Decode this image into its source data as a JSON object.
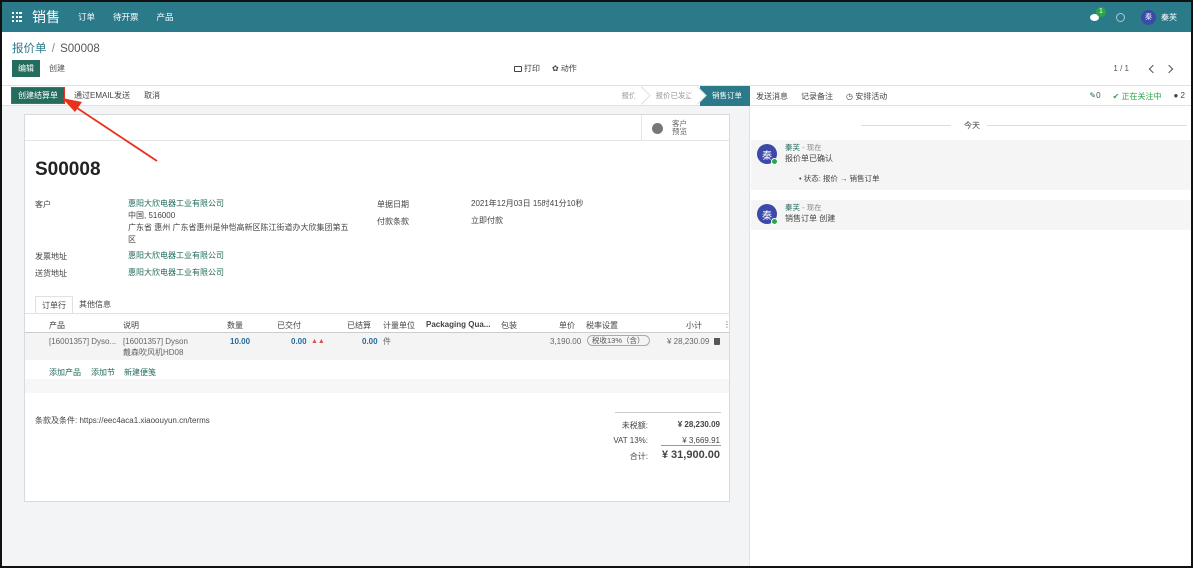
{
  "navbar": {
    "brand": "销售",
    "menu": [
      "订单",
      "待开票",
      "产品"
    ],
    "chat_badge": "1",
    "user_initial": "秦",
    "user_name": "秦芙"
  },
  "control": {
    "breadcrumb_parent": "报价单",
    "breadcrumb_sep": "/",
    "breadcrumb_current": "S00008",
    "edit": "编辑",
    "create": "创建",
    "print": "打印",
    "action": "动作",
    "pager": "1 / 1"
  },
  "statusbar": {
    "create_invoice": "创建结算单",
    "send_email": "通过EMAIL发送",
    "cancel": "取消",
    "stages": [
      "报价",
      "报价已发送",
      "销售订单"
    ],
    "active_stage": "销售订单"
  },
  "sheet": {
    "preview_label": "客户预览",
    "title": "S00008",
    "customer_label": "客户",
    "customer_name": "惠阳大欣电器工业有限公司",
    "customer_addr1": "中国, 516000",
    "customer_addr2": "广东省 惠州 广东省惠州是仲恺高新区陈江街道办大欣集团第五",
    "customer_addr3": "区",
    "invoice_addr_label": "发票地址",
    "invoice_addr": "惠阳大欣电器工业有限公司",
    "delivery_addr_label": "送货地址",
    "delivery_addr": "惠阳大欣电器工业有限公司",
    "date_label": "单据日期",
    "date_value": "2021年12月03日 15时41分10秒",
    "terms_label": "付款条款",
    "terms_value": "立即付款",
    "tabs": [
      "订单行",
      "其他信息"
    ],
    "columns": {
      "product": "产品",
      "description": "说明",
      "qty": "数量",
      "delivered": "已交付",
      "invoiced": "已结算",
      "uom": "计量单位",
      "packaging_qty": "Packaging Qua...",
      "package": "包装",
      "price": "单价",
      "tax": "税率设置",
      "subtotal": "小计"
    },
    "line": {
      "product": "[16001357] Dyso...",
      "desc1": "[16001357] Dyson",
      "desc2": "戴森吹风机HD08",
      "qty": "10.00",
      "delivered": "0.00",
      "invoiced": "0.00",
      "uom": "件",
      "price": "3,190.00",
      "tax": "税收13%（含）",
      "subtotal": "¥ 28,230.09"
    },
    "add_product": "添加产品",
    "add_section": "添加节",
    "add_note": "新建便笺",
    "terms_text": "条款及条件: https://eec4aca1.xiaoouyun.cn/terms",
    "untaxed_label": "未税额:",
    "untaxed_value": "¥ 28,230.09",
    "vat_label": "VAT 13%:",
    "vat_value": "¥ 3,669.91",
    "total_label": "合计:",
    "total_value": "¥ 31,900.00"
  },
  "chatter": {
    "send_message": "发送消息",
    "log_note": "记录备注",
    "schedule_activity": "安排活动",
    "attachments": "0",
    "following": "正在关注中",
    "followers": "2",
    "today": "今天",
    "messages": [
      {
        "initial": "秦",
        "author": "秦芙",
        "time": "- 现在",
        "body": "报价单已确认",
        "tracking": "状态: 报价 → 销售订单"
      },
      {
        "initial": "秦",
        "author": "秦芙",
        "time": "- 现在",
        "body": "销售订单 创建"
      }
    ]
  },
  "colors": {
    "navbar": "#2b7a8a",
    "primary_button": "#246c5d",
    "link": "#246c5d",
    "annotation_arrow": "#e8321e"
  }
}
